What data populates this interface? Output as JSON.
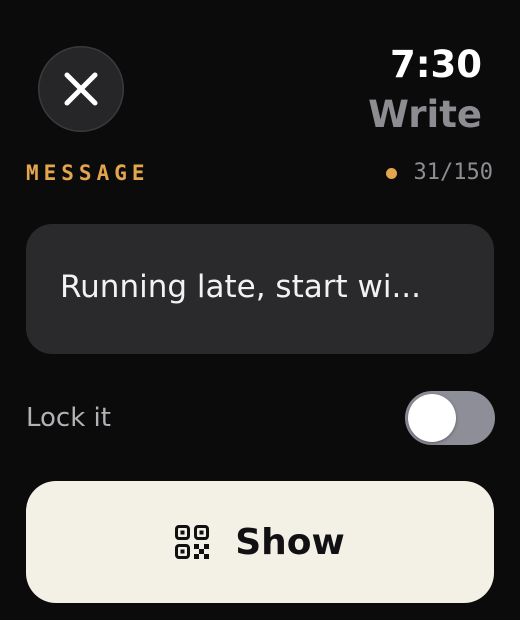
{
  "status_bar": {
    "time": "7:30"
  },
  "header": {
    "title": "Write",
    "close_icon": "close-icon"
  },
  "message": {
    "section_label": "MESSAGE",
    "counter": "31/150",
    "value": "Running late, start wi..."
  },
  "lock": {
    "label": "Lock it",
    "enabled": false
  },
  "show_button": {
    "label": "Show",
    "icon": "qr-code-icon"
  },
  "colors": {
    "background": "#0c0b0c",
    "accent": "#e3a54d",
    "button_background": "#f3f0e6",
    "field_background": "#2a292c",
    "secondary_text": "#8d8c91",
    "toggle_off": "#8d8e98"
  }
}
